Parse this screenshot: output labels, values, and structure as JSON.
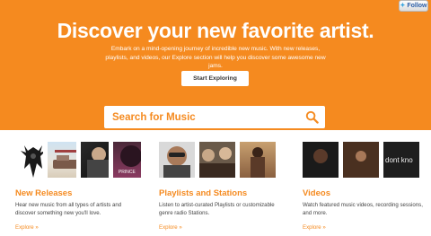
{
  "twitter": {
    "follow_label": "Follow"
  },
  "hero": {
    "title": "Discover your new favorite artist.",
    "description": "Embark on a mind-opening journey of incredible new music. With new releases, playlists, and videos, our Explore section will help you discover some awesome new jams.",
    "cta_label": "Start Exploring"
  },
  "search": {
    "placeholder": "Search for Music",
    "value": ""
  },
  "columns": [
    {
      "title": "New Releases",
      "description": "Hear new music from all types of artists and discover something new you'll love.",
      "link": "Explore »",
      "thumbnail_captions": [
        "",
        "",
        "",
        "PRINCE"
      ]
    },
    {
      "title": "Playlists and Stations",
      "description": "Listen to artist-curated Playlists or customizable genre radio Stations.",
      "link": "Explore »"
    },
    {
      "title": "Videos",
      "description": "Watch featured music videos, recording sessions, and more.",
      "link": "Explore »",
      "thumbnail_overlay": "dont kno"
    }
  ],
  "colors": {
    "brand_orange": "#f58a1f",
    "white": "#ffffff",
    "body_text": "#444444"
  }
}
